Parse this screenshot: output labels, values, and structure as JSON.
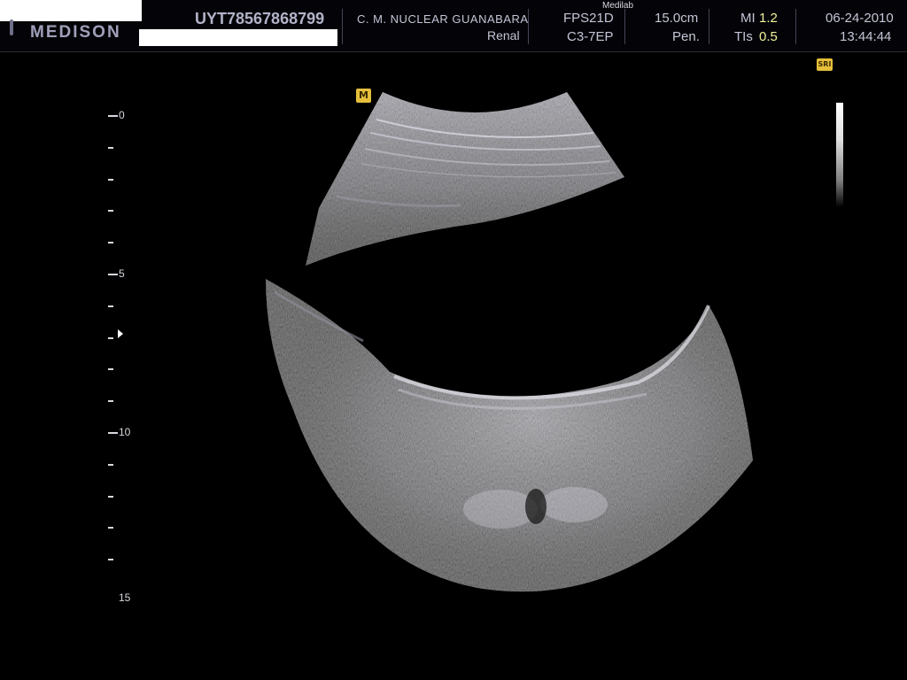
{
  "header": {
    "brand": "MEDISON",
    "patient_id": "UYT78567868799",
    "facility": "C. M. NUCLEAR  GUANABARA",
    "preset": "Renal",
    "watermark": "Medilab",
    "frame_mode": "FPS21D",
    "probe": "C3-7EP",
    "depth": "15.0cm",
    "frequency_mode": "Pen.",
    "mi_label": "MI",
    "mi_value": "1.2",
    "tis_label": "TIs",
    "tis_value": "0.5",
    "date": "06-24-2010",
    "time": "13:44:44"
  },
  "badges": {
    "sri": "SRI",
    "orientation": "M"
  },
  "ruler": {
    "labels": [
      "0",
      "5",
      "10",
      "15"
    ],
    "focus_depth_cm": 6.9,
    "max_depth_cm": 15
  },
  "colors": {
    "badge": "#e5bf3b",
    "value_highlight": "#f2f29a",
    "header_text": "#c4c5d6"
  }
}
